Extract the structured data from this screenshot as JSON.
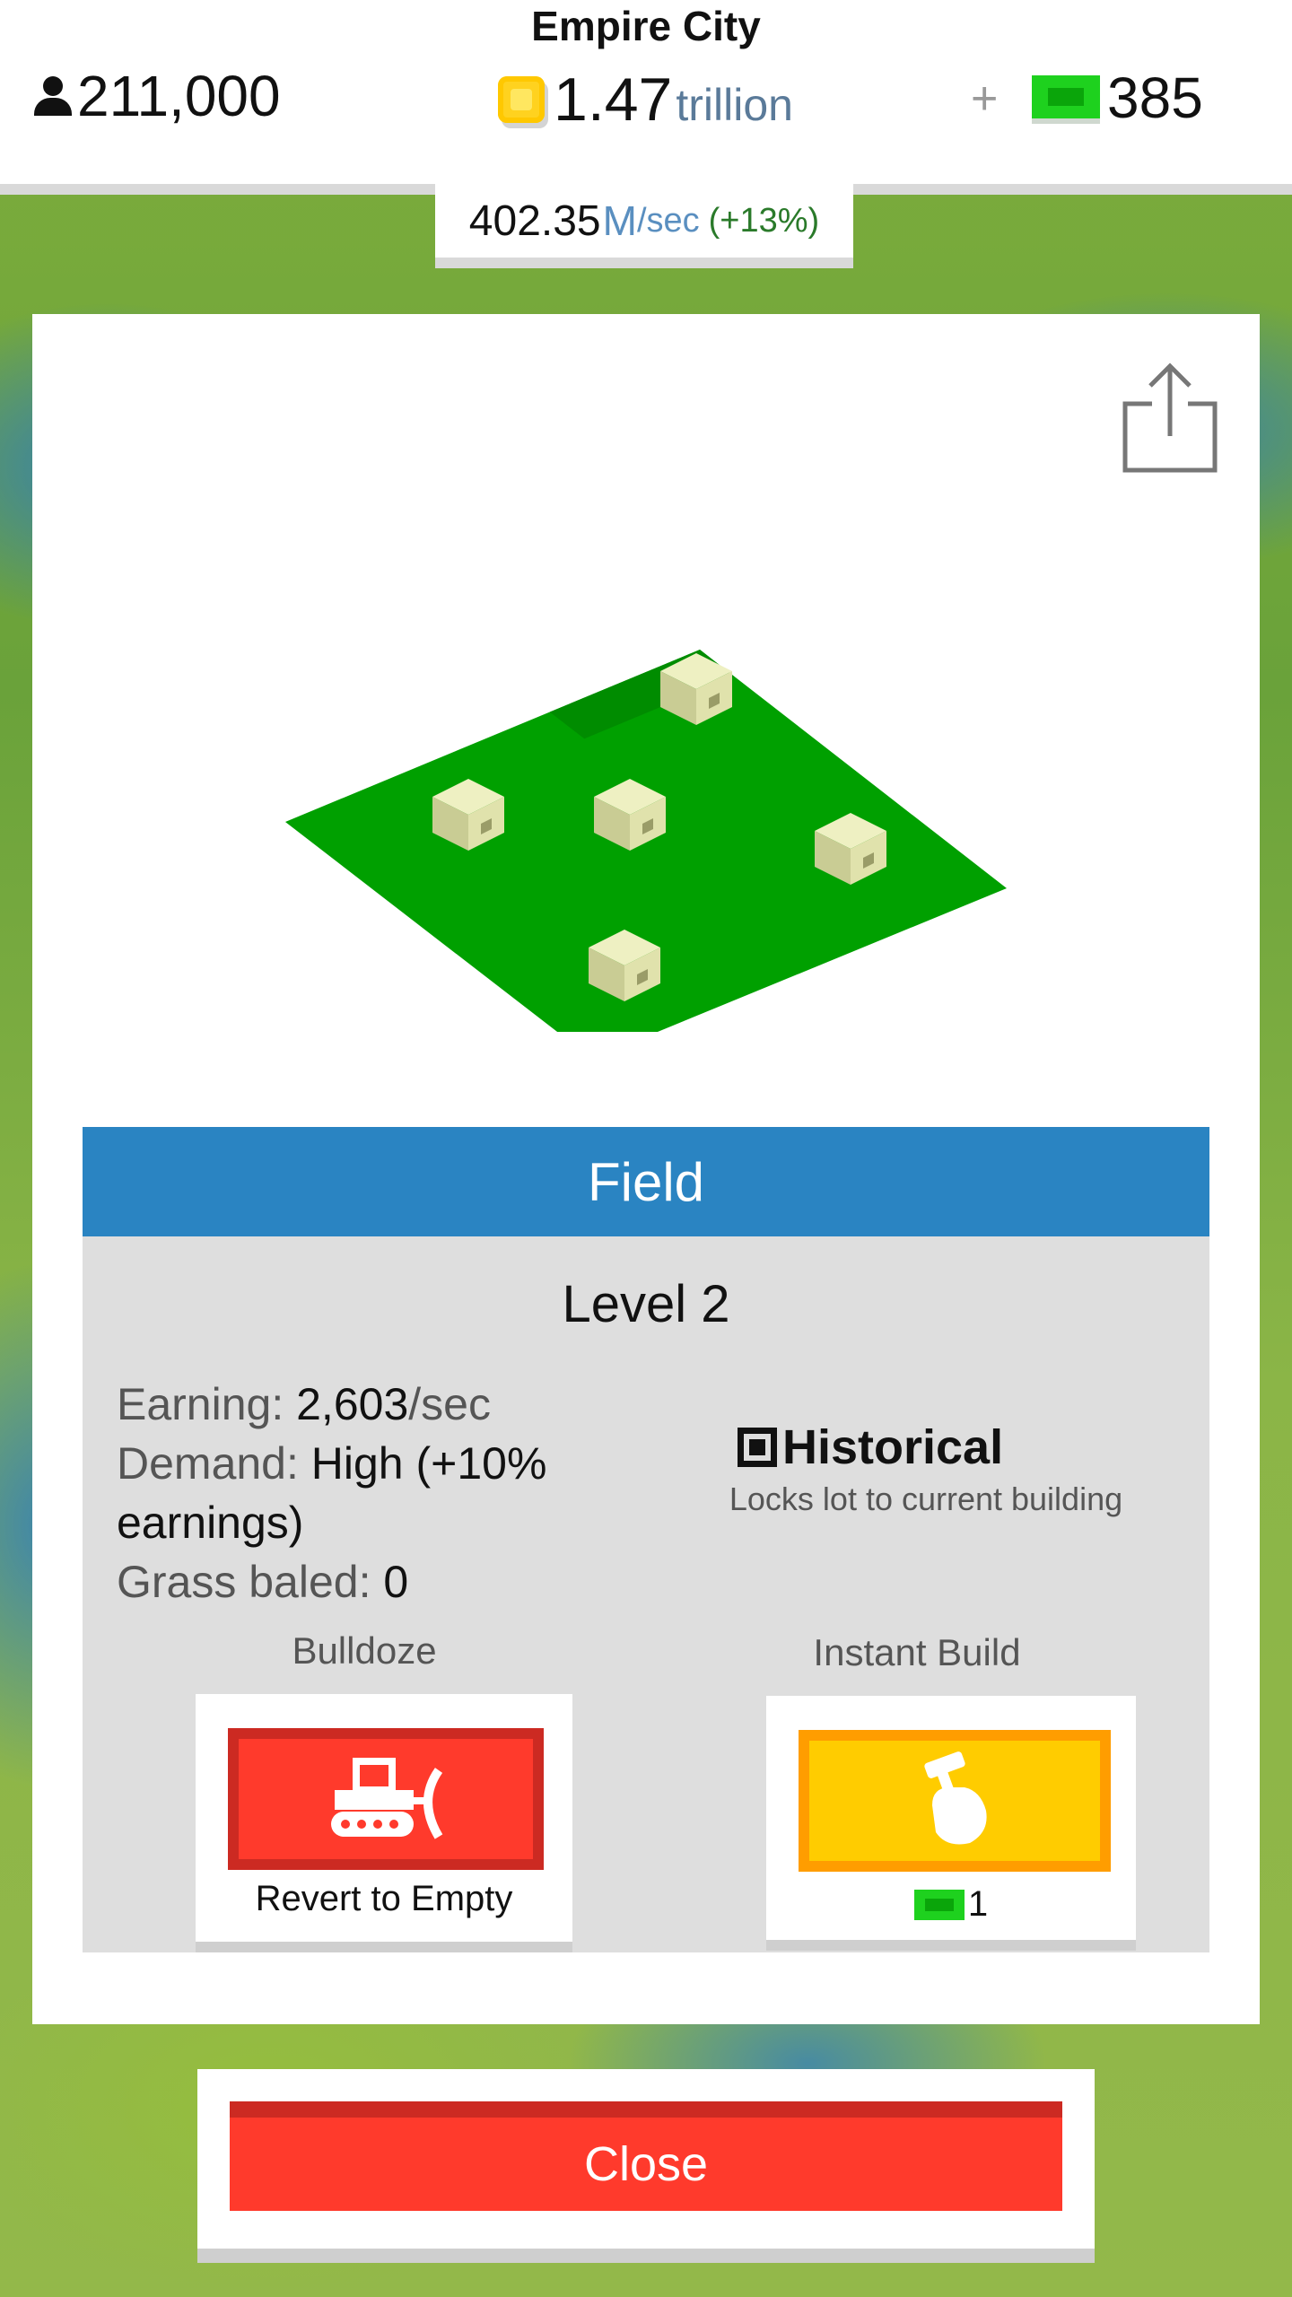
{
  "header": {
    "city_name": "Empire City",
    "population": "211,000",
    "money_value": "1.47",
    "money_unit": "trillion",
    "plus_label": "+",
    "cash_value": "385"
  },
  "income": {
    "value": "402.35",
    "unit": "M",
    "per": "/sec",
    "bonus": "(+13%)"
  },
  "panel": {
    "share_icon": "share-icon",
    "building_name": "Field",
    "level": "Level 2",
    "earning_label": "Earning: ",
    "earning_value": "2,603",
    "earning_unit": "/sec",
    "demand_label": "Demand: ",
    "demand_value": "High (+10% earnings)",
    "grass_label": "Grass baled: ",
    "grass_value": "0",
    "historical_title": "Historical",
    "historical_checked": true,
    "historical_sub": "Locks lot to current building",
    "bulldoze_label": "Bulldoze",
    "bulldoze_button_text": "Revert to Empty",
    "instant_build_label": "Instant Build",
    "instant_build_cost": "1"
  },
  "close_label": "Close",
  "colors": {
    "header_blue": "#2a84c2",
    "bulldoze_red": "#ff3a2c",
    "build_yellow": "#ffcc00",
    "cash_green": "#1ed11e",
    "field_green": "#00a000"
  }
}
